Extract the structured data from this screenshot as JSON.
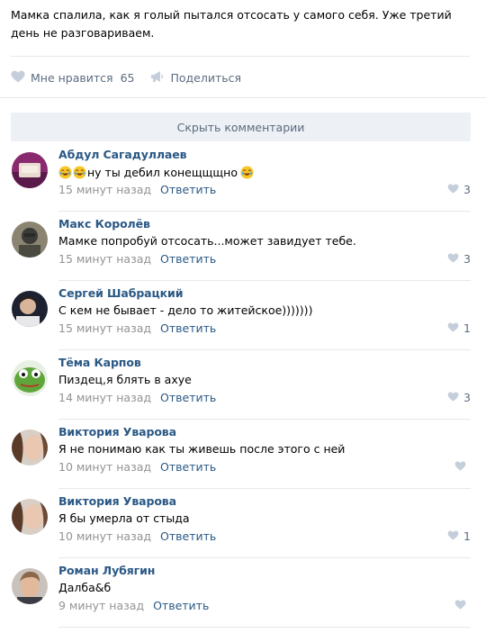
{
  "post": {
    "text": "Мамка спалила, как я голый пытался отсосать у самого себя. Уже третий день не разговариваем."
  },
  "actions": {
    "like_label": "Мне нравится",
    "like_count": "65",
    "share_label": "Поделиться"
  },
  "hide_comments_label": "Скрыть комментарии",
  "colors": {
    "link": "#2a5885",
    "muted": "#939393",
    "action": "#5b6c80",
    "divider": "#e7e8ec",
    "button_bg": "#edf0f4"
  },
  "comments": [
    {
      "author": "Абдул Сагадуллаев",
      "text": "ну ты дебил конещщщно",
      "emoji_prefix": "face-with-tears-of-joy x2",
      "emoji_suffix": "face-with-tears-of-joy",
      "time": "15 минут назад",
      "reply": "Ответить",
      "likes": "3"
    },
    {
      "author": "Макс Королёв",
      "text": "Мамке попробуй отсосать...может завидует тебе.",
      "time": "15 минут назад",
      "reply": "Ответить",
      "likes": "3"
    },
    {
      "author": "Сергей Шабрацкий",
      "text": "С кем не бывает - дело то житейское)))))))",
      "time": "15 минут назад",
      "reply": "Ответить",
      "likes": "1"
    },
    {
      "author": "Тёма Карпов",
      "text": "Пиздец,я блять в ахуе",
      "time": "14 минут назад",
      "reply": "Ответить",
      "likes": "3"
    },
    {
      "author": "Виктория Уварова",
      "text": "Я не понимаю как ты живешь после этого с ней",
      "time": "10 минут назад",
      "reply": "Ответить",
      "likes": ""
    },
    {
      "author": "Виктория Уварова",
      "text": "Я бы умерла от стыда",
      "time": "10 минут назад",
      "reply": "Ответить",
      "likes": "1"
    },
    {
      "author": "Роман Лубягин",
      "text": "Далба&б",
      "time": "9 минут назад",
      "reply": "Ответить",
      "likes": ""
    }
  ]
}
